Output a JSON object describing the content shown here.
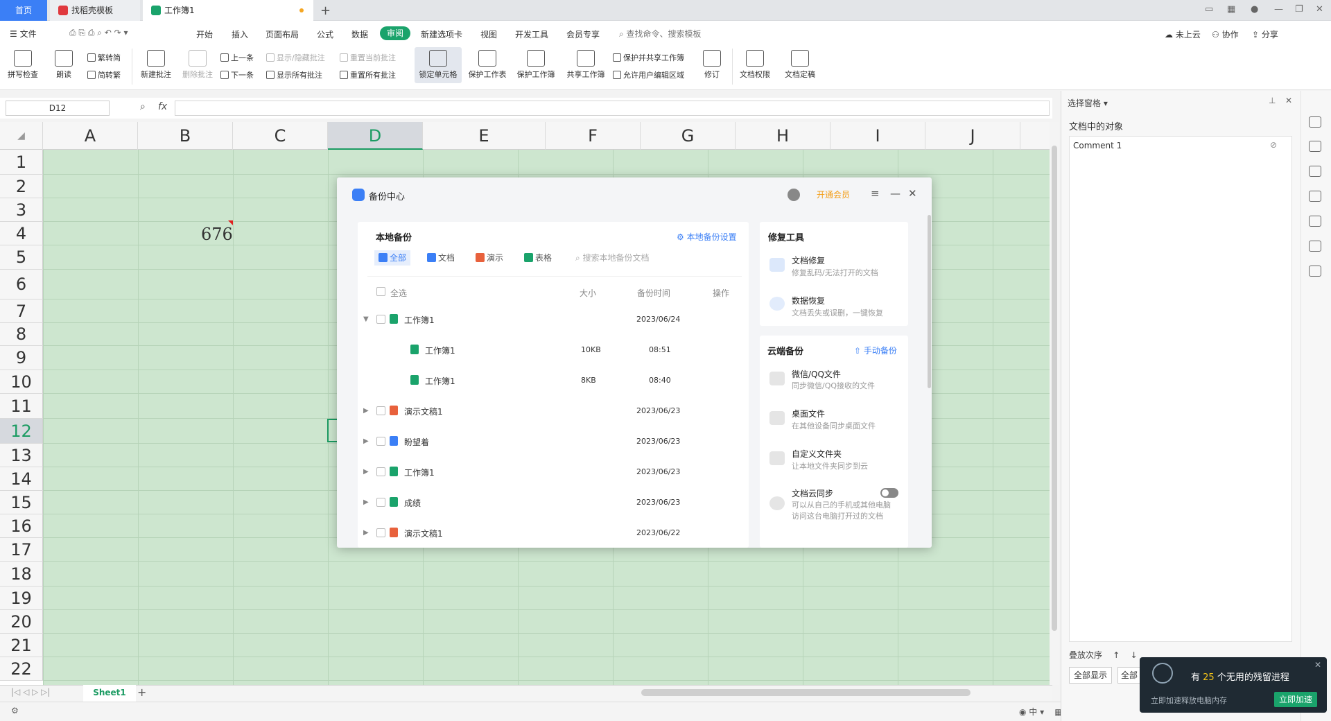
{
  "tabs": {
    "home": "首页",
    "t2": "找稻壳模板",
    "t3": "工作簿1",
    "new": "+"
  },
  "menu": [
    "文件",
    "开始",
    "插入",
    "页面布局",
    "公式",
    "数据",
    "审阅",
    "新建选项卡",
    "视图",
    "开发工具",
    "会员专享"
  ],
  "menu_search": "查找命令、搜索模板",
  "menu_right": {
    "cloud": "未上云",
    "collab": "协作",
    "share": "分享"
  },
  "ribbon": {
    "spell": "拼写检查",
    "read": "朗读",
    "t2s": "繁转简",
    "s2t": "简转繁",
    "newcomment": "新建批注",
    "delcomment": "删除批注",
    "prev": "上一条",
    "next": "下一条",
    "showhide": "显示/隐藏批注",
    "showall": "显示所有批注",
    "resetcur": "重置当前批注",
    "resetall": "重置所有批注",
    "lockcell": "锁定单元格",
    "protectsheet": "保护工作表",
    "protectbook": "保护工作簿",
    "sharebook": "共享工作簿",
    "protectshare": "保护并共享工作簿",
    "allowedit": "允许用户编辑区域",
    "revise": "修订",
    "docperm": "文档权限",
    "docfinal": "文档定稿"
  },
  "namebox": "D12",
  "fx": "fx",
  "columns": [
    "A",
    "B",
    "C",
    "D",
    "E",
    "F",
    "G",
    "H",
    "I",
    "J"
  ],
  "rows": [
    "1",
    "2",
    "3",
    "4",
    "5",
    "6",
    "7",
    "8",
    "9",
    "10",
    "11",
    "12",
    "13",
    "14",
    "15",
    "16",
    "17",
    "18",
    "19",
    "20",
    "21",
    "22"
  ],
  "cell_b4": "676",
  "sheet": "Sheet1",
  "pane": {
    "title": "选择窗格",
    "objects_label": "文档中的对象",
    "item": "Comment 1",
    "stack": "叠放次序",
    "showall": "全部显示",
    "all2": "全部"
  },
  "modal": {
    "title": "备份中心",
    "vip": "开通会员",
    "local": "本地备份",
    "local_settings": "本地备份设置",
    "filters": [
      "全部",
      "文档",
      "演示",
      "表格"
    ],
    "search": "搜索本地备份文档",
    "head": {
      "selectall": "全选",
      "size": "大小",
      "time": "备份时间",
      "op": "操作"
    },
    "rows": [
      {
        "name": "工作簿1",
        "size": "",
        "date": "2023/06/24",
        "type": "sheet",
        "arrow": "▼",
        "child": false
      },
      {
        "name": "工作簿1",
        "size": "10KB",
        "date": "08:51",
        "type": "sheet",
        "arrow": "",
        "child": true
      },
      {
        "name": "工作簿1",
        "size": "8KB",
        "date": "08:40",
        "type": "sheet",
        "arrow": "",
        "child": true
      },
      {
        "name": "演示文稿1",
        "size": "",
        "date": "2023/06/23",
        "type": "ppt",
        "arrow": "▶",
        "child": false
      },
      {
        "name": "盼望着",
        "size": "",
        "date": "2023/06/23",
        "type": "doc",
        "arrow": "▶",
        "child": false
      },
      {
        "name": "工作簿1",
        "size": "",
        "date": "2023/06/23",
        "type": "sheet",
        "arrow": "▶",
        "child": false
      },
      {
        "name": "成绩",
        "size": "",
        "date": "2023/06/23",
        "type": "sheet",
        "arrow": "▶",
        "child": false
      },
      {
        "name": "演示文稿1",
        "size": "",
        "date": "2023/06/22",
        "type": "ppt",
        "arrow": "▶",
        "child": false
      }
    ],
    "repair": "修复工具",
    "docfix": "文档修复",
    "docfix_desc": "修复乱码/无法打开的文档",
    "datarec": "数据恢复",
    "datarec_desc": "文档丢失或误删，一键恢复",
    "cloud": "云端备份",
    "manual": "手动备份",
    "wechat": "微信/QQ文件",
    "wechat_desc": "同步微信/QQ接收的文件",
    "desktop": "桌面文件",
    "desktop_desc": "在其他设备同步桌面文件",
    "custom": "自定义文件夹",
    "custom_desc": "让本地文件夹同步到云",
    "sync": "文档云同步",
    "sync_desc1": "可以从自己的手机或其他电脑",
    "sync_desc2": "访问这台电脑打开过的文档"
  },
  "notif": {
    "pre": "有",
    "count": "25",
    "post": "个无用的残留进程",
    "sub": "立即加速释放电脑内存",
    "btn": "立即加速"
  },
  "colors": {
    "accent": "#1aa36b",
    "blue": "#3b7ff6",
    "sheet": "#1aa36b",
    "ppt": "#e8613c",
    "doc": "#3b7ff6"
  }
}
